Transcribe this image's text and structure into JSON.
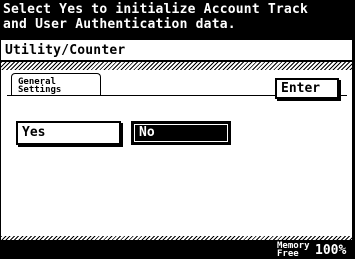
{
  "message": "Select Yes to initialize Account Track\nand User Authentication data.",
  "screen_title": "Utility/Counter",
  "section_tab": "General\nSettings",
  "buttons": {
    "enter": "Enter",
    "yes": "Yes",
    "no": "No"
  },
  "selected_option": "No",
  "status_bar": {
    "memory_label": "Memory\nFree",
    "memory_value": "100%"
  },
  "colors": {
    "background": "#000000",
    "panel": "#ffffff",
    "selected": "#000000"
  }
}
